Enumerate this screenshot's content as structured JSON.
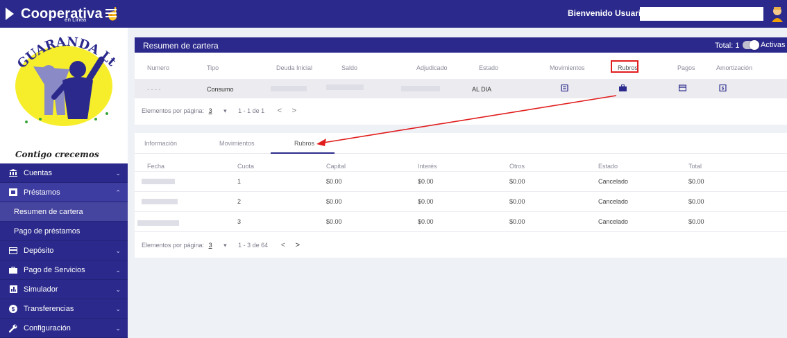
{
  "header": {
    "brand": "Cooperativa",
    "brand_sub": "en Línea",
    "welcome": "Bienvenido Usuario: E"
  },
  "sidebar": {
    "logo_text": "GUARANDA Ltda.",
    "slogan": "Contigo crecemos",
    "items": [
      {
        "label": "Cuentas",
        "icon": "bank-icon"
      },
      {
        "label": "Préstamos",
        "icon": "loan-icon"
      },
      {
        "label": "Depósito",
        "icon": "card-icon"
      },
      {
        "label": "Pago de Servicios",
        "icon": "briefcase-icon"
      },
      {
        "label": "Simulador",
        "icon": "chart-icon"
      },
      {
        "label": "Transferencias",
        "icon": "dollar-icon"
      },
      {
        "label": "Configuración",
        "icon": "wrench-icon"
      }
    ],
    "sub_items": [
      {
        "label": "Resumen de cartera"
      },
      {
        "label": "Pago de préstamos"
      }
    ]
  },
  "portfolio": {
    "title": "Resumen de cartera",
    "total_label": "Total: 1",
    "active_label": "Activas",
    "columns": [
      "Numero",
      "Tipo",
      "Deuda Inicial",
      "Saldo",
      "Adjudicado",
      "Estado",
      "Movimientos",
      "Rubros",
      "Pagos",
      "Amortización"
    ],
    "row": {
      "numero": "- - - -",
      "tipo": "Consumo",
      "estado": "AL DIA"
    },
    "pager": {
      "label": "Elementos por página:",
      "size": "3",
      "range": "1 - 1 de 1"
    }
  },
  "details": {
    "tabs": [
      "Información",
      "Movimientos",
      "Rubros"
    ],
    "active_tab": "Rubros",
    "columns": [
      "Fecha",
      "Cuota",
      "Capital",
      "Interés",
      "Otros",
      "Estado",
      "Total"
    ],
    "rows": [
      {
        "cuota": "1",
        "capital": "$0.00",
        "interes": "$0.00",
        "otros": "$0.00",
        "estado": "Cancelado",
        "total": "$0.00"
      },
      {
        "cuota": "2",
        "capital": "$0.00",
        "interes": "$0.00",
        "otros": "$0.00",
        "estado": "Cancelado",
        "total": "$0.00"
      },
      {
        "cuota": "3",
        "capital": "$0.00",
        "interes": "$0.00",
        "otros": "$0.00",
        "estado": "Cancelado",
        "total": "$0.00"
      }
    ],
    "pager": {
      "label": "Elementos por página:",
      "size": "3",
      "range": "1 - 3 de 64"
    }
  },
  "colors": {
    "primary": "#2b2a8c",
    "highlight": "#e11c1c"
  }
}
